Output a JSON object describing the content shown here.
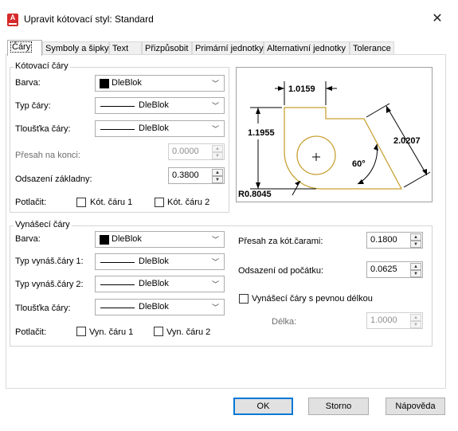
{
  "window": {
    "title": "Upravit kótovací styl: Standard",
    "app_icon_letter": "A"
  },
  "tabs": [
    {
      "label": "Čáry"
    },
    {
      "label": "Symboly a šipky"
    },
    {
      "label": "Text"
    },
    {
      "label": "Přizpůsobit"
    },
    {
      "label": "Primární jednotky"
    },
    {
      "label": "Alternativní jednotky"
    },
    {
      "label": "Tolerance"
    }
  ],
  "dim_lines": {
    "group_title": "Kótovací čáry",
    "color_label": "Barva:",
    "color_value": "DleBlok",
    "linetype_label": "Typ čáry:",
    "linetype_value": "DleBlok",
    "lineweight_label": "Tloušťka čáry:",
    "lineweight_value": "DleBlok",
    "extend_label": "Přesah na konci:",
    "extend_value": "0.0000",
    "baseline_label": "Odsazení základny:",
    "baseline_value": "0.3800",
    "suppress_label": "Potlačit:",
    "suppress_1": "Kót. čáru 1",
    "suppress_2": "Kót. čáru 2"
  },
  "ext_lines": {
    "group_title": "Vynášecí čáry",
    "color_label": "Barva:",
    "color_value": "DleBlok",
    "linetype1_label": "Typ vynáš.čáry 1:",
    "linetype1_value": "DleBlok",
    "linetype2_label": "Typ vynáš.čáry 2:",
    "linetype2_value": "DleBlok",
    "lineweight_label": "Tloušťka čáry:",
    "lineweight_value": "DleBlok",
    "suppress_label": "Potlačit:",
    "suppress_1": "Vyn. čáru 1",
    "suppress_2": "Vyn. čáru 2",
    "extend_beyond_label": "Přesah za kót.čarami:",
    "extend_beyond_value": "0.1800",
    "offset_label": "Odsazení od počátku:",
    "offset_value": "0.0625",
    "fixed_length_label": "Vynášecí čáry s pevnou délkou",
    "length_label": "Délka:",
    "length_value": "1.0000"
  },
  "preview": {
    "dim_top": "1.0159",
    "dim_left": "1.1955",
    "dim_right": "2.0207",
    "dim_angle": "60°",
    "dim_radius": "R0.8045",
    "part_color": "#c8a233"
  },
  "buttons": {
    "ok": "OK",
    "cancel": "Storno",
    "help": "Nápověda"
  }
}
